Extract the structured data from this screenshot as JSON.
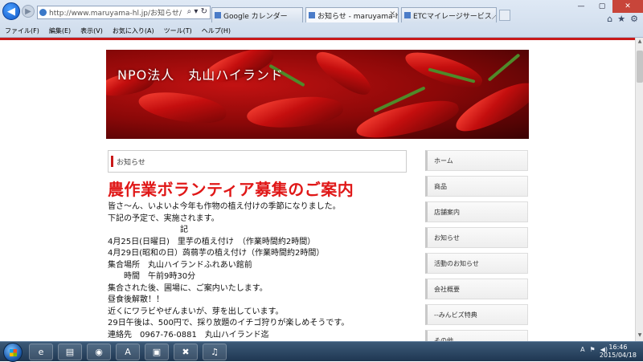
{
  "browser": {
    "url": "http://www.maruyama-hl.jp/お知らせ/",
    "tabs": [
      {
        "label": "Google カレンダー"
      },
      {
        "label": "お知らせ - maruyama-hl ..."
      },
      {
        "label": "ETCマイレージサービス／自..."
      }
    ],
    "menu": [
      "ファイル(F)",
      "編集(E)",
      "表示(V)",
      "お気に入り(A)",
      "ツール(T)",
      "ヘルプ(H)"
    ]
  },
  "site": {
    "title": "NPO法人　丸山ハイランド"
  },
  "main": {
    "section_label": "お知らせ",
    "headline": "農作業ボランティア募集のご案内",
    "body_lines": [
      "皆さ～ん、いよいよ今年も作物の植え付けの季節になりました。",
      "下記の予定で、実施されます。",
      "　　　　　　　　　記",
      "4月25日(日曜日)　里芋の植え付け　（作業時間約2時間）",
      "4月29日(昭和の日）蒟蒻芋の植え付け（作業時間約2時間）",
      "集合場所　丸山ハイランドふれあい館前",
      "　　時間　午前9時30分",
      "集合された後、圃場に、ご案内いたします。",
      "昼食後解散！！",
      "近くにワラビやぜんまいが、芽を出しています。",
      "29日午後は、500円で、採り放題のイチゴ狩りが楽しめそうです。",
      "連絡先　0967-76-0881　丸山ハイランド迄"
    ]
  },
  "sidebar": {
    "items": [
      {
        "label": "ホーム"
      },
      {
        "label": "商品"
      },
      {
        "label": "店舗案内"
      },
      {
        "label": "お知らせ"
      },
      {
        "label": "活動のお知らせ"
      },
      {
        "label": "会社概要"
      },
      {
        "label": "--みんビズ特典"
      },
      {
        "label": "その他"
      }
    ]
  },
  "taskbar": {
    "time": "16:46",
    "date": "2015/04/18"
  },
  "colors": {
    "accent_red": "#c91a1a",
    "headline_red": "#e01818"
  }
}
